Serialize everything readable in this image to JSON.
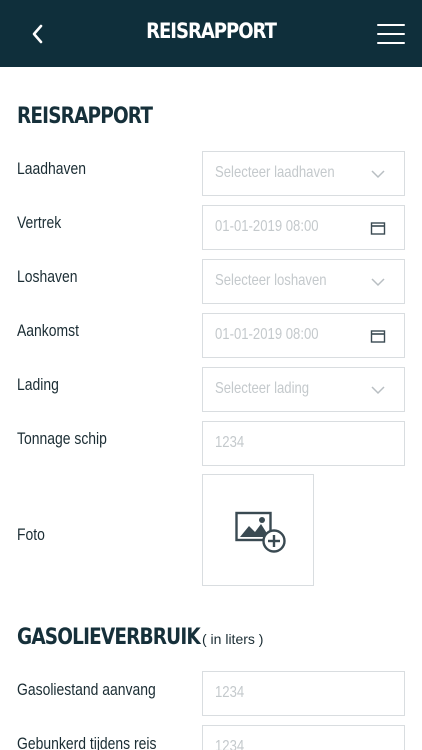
{
  "header": {
    "title": "REISRAPPORT"
  },
  "section_reis": {
    "title": "REISRAPPORT",
    "fields": [
      {
        "label": "Laadhaven",
        "value": "Selecteer laadhaven",
        "icon": "chevron-down-icon"
      },
      {
        "label": "Vertrek",
        "value": "01-01-2019 08:00",
        "icon": "calendar-icon"
      },
      {
        "label": "Loshaven",
        "value": "Selecteer loshaven",
        "icon": "chevron-down-icon"
      },
      {
        "label": "Aankomst",
        "value": "01-01-2019 08:00",
        "icon": "calendar-icon"
      },
      {
        "label": "Lading",
        "value": "Selecteer lading",
        "icon": "chevron-down-icon"
      },
      {
        "label": "Tonnage schip",
        "placeholder": "1234"
      }
    ],
    "photo": {
      "label": "Foto",
      "icon": "add-image-icon"
    }
  },
  "section_gasolie": {
    "title": "GASOLIEVERBRUIK",
    "unit_note": "( in liters )",
    "fields": [
      {
        "label": "Gasoliestand aanvang",
        "placeholder": "1234"
      },
      {
        "label": "Gebunkerd tijdens reis",
        "placeholder": "1234"
      }
    ]
  },
  "colors": {
    "header_bg": "#0f2f3b",
    "border": "#d9dde0",
    "placeholder": "#c4c9cc",
    "text": "#1a2c33"
  }
}
